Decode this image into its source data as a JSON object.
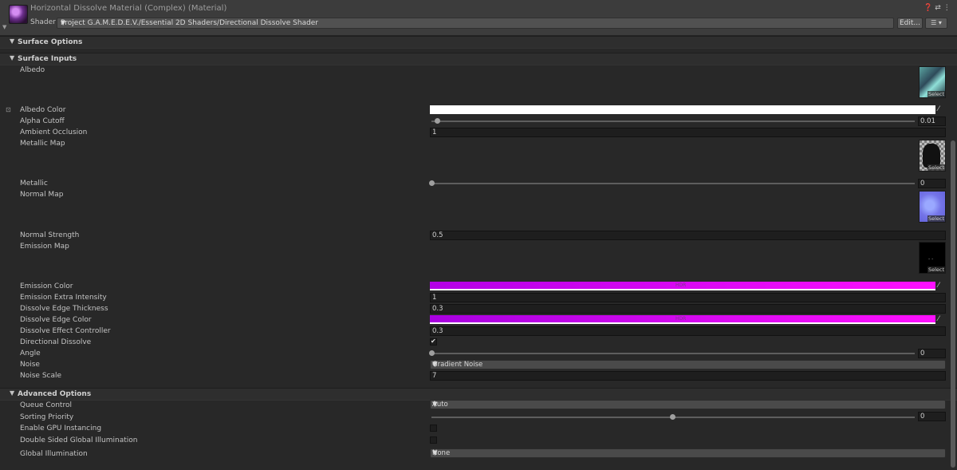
{
  "header": {
    "title": "Horizontal Dissolve Material (Complex) (Material)",
    "shader_label": "Shader",
    "shader_path": "Project G.A.M.E.D.E.V./Essential 2D Shaders/Directional Dissolve Shader",
    "edit_label": "Edit...",
    "menu_glyph": "☰ ▾",
    "icons": [
      "help-icon",
      "preset-icon",
      "more-icon"
    ],
    "icon_glyphs": "❓⇄⋮"
  },
  "sections": {
    "surface_options": "Surface Options",
    "surface_inputs": "Surface Inputs",
    "advanced_options": "Advanced Options"
  },
  "surface_inputs": {
    "albedo": {
      "label": "Albedo",
      "select": "Select"
    },
    "albedo_color": {
      "label": "Albedo Color",
      "color": "#ffffff"
    },
    "alpha_cutoff": {
      "label": "Alpha Cutoff",
      "value": "0.01",
      "fraction": 0.01
    },
    "ambient_occlusion": {
      "label": "Ambient Occlusion",
      "value": "1"
    },
    "metallic_map": {
      "label": "Metallic Map",
      "select": "Select"
    },
    "metallic": {
      "label": "Metallic",
      "value": "0",
      "fraction": 0.0
    },
    "normal_map": {
      "label": "Normal Map",
      "select": "Select"
    },
    "normal_strength": {
      "label": "Normal Strength",
      "value": "0.5"
    },
    "emission_map": {
      "label": "Emission Map",
      "select": "Select"
    },
    "emission_color": {
      "label": "Emission Color",
      "hdr": "HDR",
      "color_start": "#b300e6",
      "color_end": "#ff10ff"
    },
    "emission_extra_intensity": {
      "label": "Emission Extra Intensity",
      "value": "1"
    },
    "dissolve_edge_thickness": {
      "label": "Dissolve Edge Thickness",
      "value": "0.3"
    },
    "dissolve_edge_color": {
      "label": "Dissolve Edge Color",
      "hdr": "HDR",
      "color_start": "#a800e0",
      "color_end": "#ff10ff"
    },
    "dissolve_effect_controller": {
      "label": "Dissolve Effect Controller",
      "value": "0.3"
    },
    "directional_dissolve": {
      "label": "Directional Dissolve",
      "checked": "✔"
    },
    "angle": {
      "label": "Angle",
      "value": "0",
      "fraction": 0.0
    },
    "noise": {
      "label": "Noise",
      "value": "Gradient Noise"
    },
    "noise_scale": {
      "label": "Noise Scale",
      "value": "7"
    }
  },
  "advanced": {
    "queue_control": {
      "label": "Queue Control",
      "value": "Auto"
    },
    "sorting_priority": {
      "label": "Sorting Priority",
      "value": "0",
      "fraction": 0.5
    },
    "gpu_instancing": {
      "label": "Enable GPU Instancing",
      "checked": false
    },
    "double_sided_gi": {
      "label": "Double Sided Global Illumination",
      "checked": false
    },
    "global_illumination": {
      "label": "Global Illumination",
      "value": "None"
    }
  }
}
